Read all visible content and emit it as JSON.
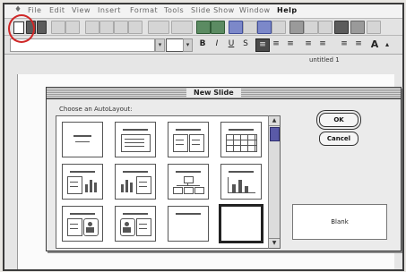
{
  "menubar": {
    "items": [
      {
        "label": "File",
        "active": false
      },
      {
        "label": "Edit",
        "active": false
      },
      {
        "label": "View",
        "active": false
      },
      {
        "label": "Insert",
        "active": false
      },
      {
        "label": "Format",
        "active": false
      },
      {
        "label": "Tools",
        "active": false
      },
      {
        "label": "Slide Show",
        "active": false
      },
      {
        "label": "Window",
        "active": false
      },
      {
        "label": "Help",
        "active": true
      }
    ]
  },
  "document": {
    "title": "untitled 1"
  },
  "highlight": {
    "color": "#cf2727",
    "target": "new-document-button"
  },
  "dialog": {
    "title": "New Slide",
    "layout_prompt": "Choose an AutoLayout:",
    "ok_label": "OK",
    "cancel_label": "Cancel",
    "preview_label": "Blank",
    "layouts": [
      {
        "icon": "title-slide-layout-icon",
        "selected": false
      },
      {
        "icon": "bulleted-list-layout-icon",
        "selected": false
      },
      {
        "icon": "two-column-text-layout-icon",
        "selected": false
      },
      {
        "icon": "table-layout-icon",
        "selected": false
      },
      {
        "icon": "text-and-chart-layout-icon",
        "selected": false
      },
      {
        "icon": "chart-and-text-layout-icon",
        "selected": false
      },
      {
        "icon": "organization-chart-layout-icon",
        "selected": false
      },
      {
        "icon": "chart-layout-icon",
        "selected": false
      },
      {
        "icon": "text-and-clip-art-layout-icon",
        "selected": false
      },
      {
        "icon": "clip-art-and-text-layout-icon",
        "selected": false
      },
      {
        "icon": "title-only-layout-icon",
        "selected": false
      },
      {
        "icon": "blank-layout-icon",
        "selected": true
      }
    ]
  }
}
